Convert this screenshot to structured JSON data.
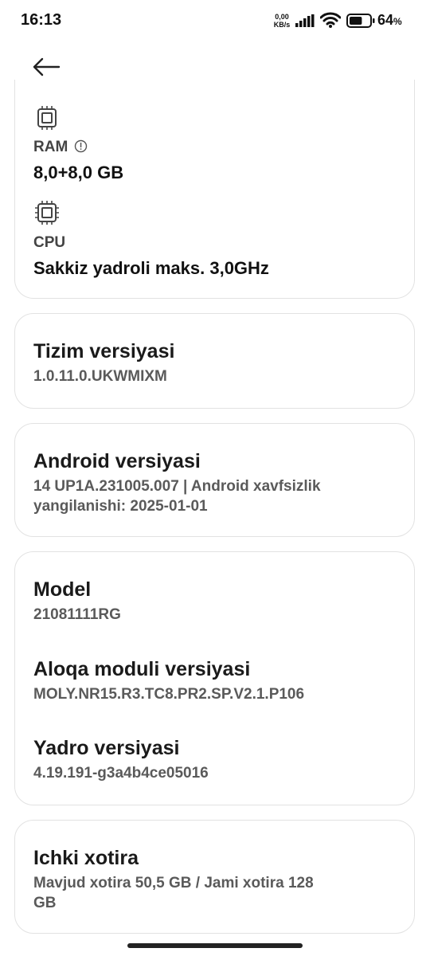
{
  "status_bar": {
    "time": "16:13",
    "net_speed_value": "0,00",
    "net_speed_unit": "KB/s",
    "battery_value": "64",
    "battery_unit": "%",
    "battery_level": 0.64
  },
  "hardware": {
    "ram_label": "RAM",
    "ram_value": "8,0+8,0 GB",
    "cpu_label": "CPU",
    "cpu_value": "Sakkiz yadroli maks. 3,0GHz"
  },
  "system_version": {
    "title": "Tizim versiyasi",
    "value": "1.0.11.0.UKWMIXM"
  },
  "android_version": {
    "title": "Android versiyasi",
    "value_line1": "14 UP1A.231005.007 | Android xavfsizlik",
    "value_line2": "yangilanishi: 2025-01-01"
  },
  "device": {
    "model_title": "Model",
    "model_value": "21081111RG",
    "baseband_title": "Aloqa moduli versiyasi",
    "baseband_value": "MOLY.NR15.R3.TC8.PR2.SP.V2.1.P106",
    "kernel_title": "Yadro versiyasi",
    "kernel_value": "4.19.191-g3a4b4ce05016"
  },
  "storage": {
    "title": "Ichki xotira",
    "value_line1": "Mavjud xotira  50,5 GB / Jami xotira  128",
    "value_line2": "GB"
  },
  "icons": {
    "back": "arrow-left-icon",
    "ram": "chip-icon",
    "cpu": "processor-icon",
    "info": "info-icon"
  }
}
